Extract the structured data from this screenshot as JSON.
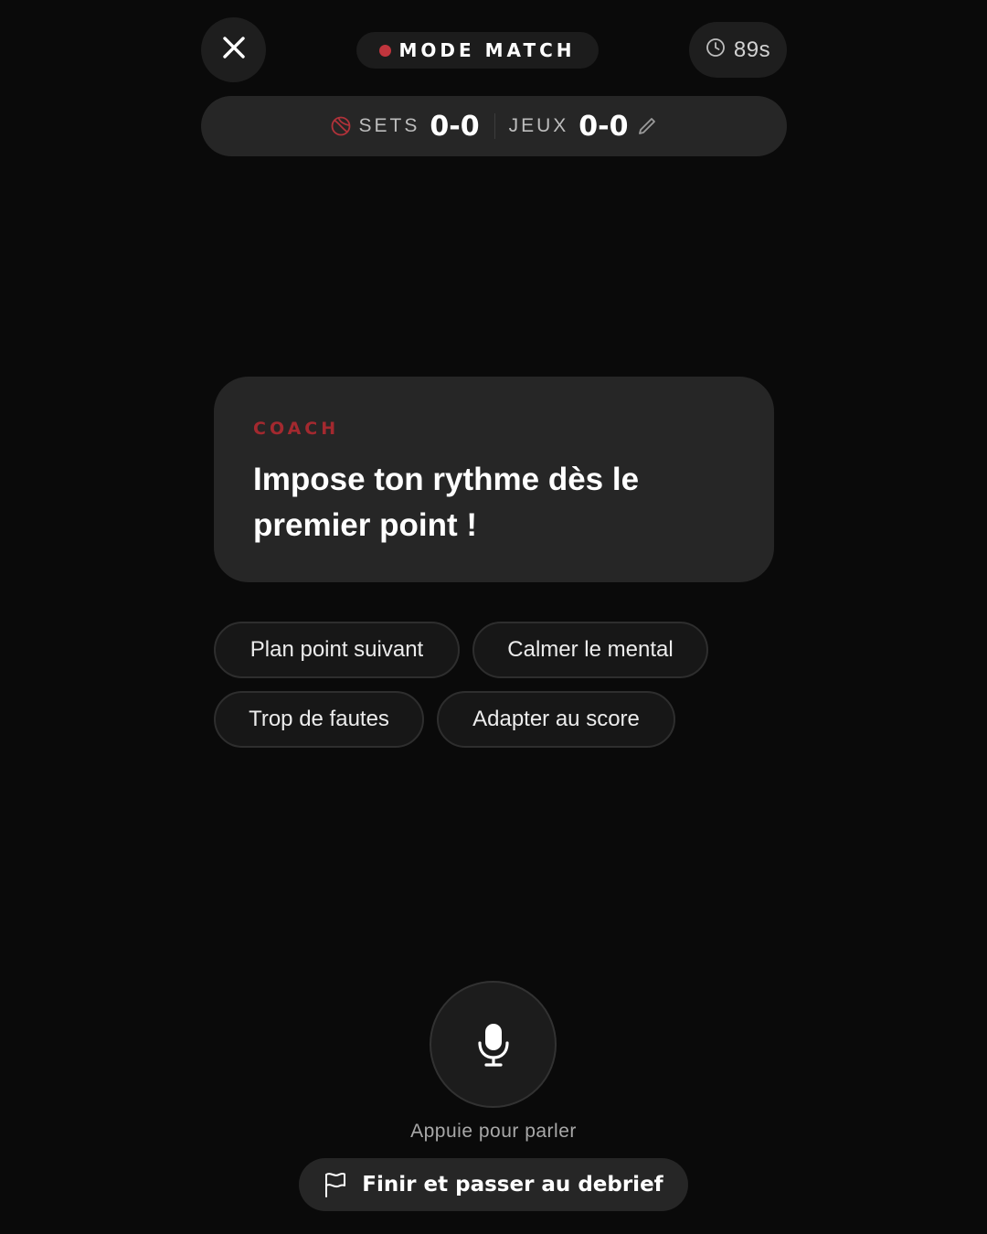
{
  "header": {
    "mode_label": "MODE MATCH",
    "timer": "89s"
  },
  "score": {
    "sets_label": "SETS",
    "sets_value": "0-0",
    "games_label": "JEUX",
    "games_value": "0-0"
  },
  "coach": {
    "label": "COACH",
    "message": "Impose ton rythme dès le premier point !"
  },
  "quick_actions": [
    {
      "label": "Plan point suivant"
    },
    {
      "label": "Calmer le mental"
    },
    {
      "label": "Trop de fautes"
    },
    {
      "label": "Adapter au score"
    }
  ],
  "mic": {
    "hint": "Appuie pour parler"
  },
  "finish": {
    "label": "Finir et passer au debrief"
  },
  "colors": {
    "background": "#0a0a0a",
    "surface": "#262626",
    "accent": "#c0353d",
    "coach_label": "#a3292f"
  },
  "icons": {
    "close": "close-icon",
    "mode": "live-dot-icon",
    "timer": "clock-icon",
    "sets": "tennis-ball-icon",
    "edit": "pencil-icon",
    "mic": "microphone-icon",
    "finish": "flag-icon"
  }
}
